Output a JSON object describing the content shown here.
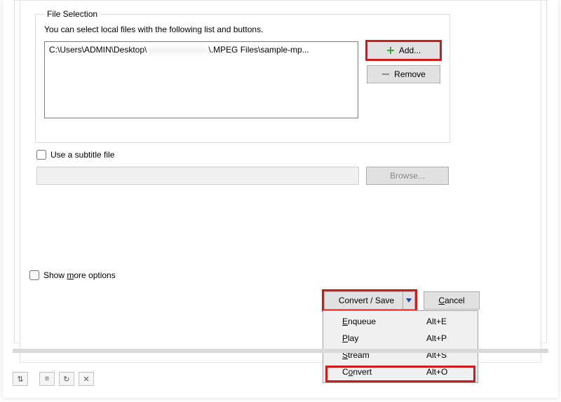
{
  "group": {
    "legend": "File Selection",
    "description": "You can select local files with the following list and buttons.",
    "file_prefix": "C:\\Users\\ADMIN\\Desktop\\",
    "file_suffix": "\\.MPEG Files\\sample-mp...",
    "add_label": "Add...",
    "remove_label": "Remove"
  },
  "subtitle": {
    "checkbox_label": "Use a subtitle file",
    "browse_label": "Browse..."
  },
  "more_options": {
    "label_pre": "Show ",
    "label_u": "m",
    "label_post": "ore options"
  },
  "footer": {
    "convert_label": "Convert / Save",
    "cancel_pre": "",
    "cancel_u": "C",
    "cancel_post": "ancel"
  },
  "menu": {
    "items": [
      {
        "label_pre": "",
        "label_u": "E",
        "label_post": "nqueue",
        "shortcut": "Alt+E"
      },
      {
        "label_pre": "",
        "label_u": "P",
        "label_post": "lay",
        "shortcut": "Alt+P"
      },
      {
        "label_pre": "",
        "label_u": "S",
        "label_post": "tream",
        "shortcut": "Alt+S"
      },
      {
        "label_pre": "C",
        "label_u": "o",
        "label_post": "nvert",
        "shortcut": "Alt+O"
      }
    ]
  },
  "highlight_color": "#d21a1a"
}
